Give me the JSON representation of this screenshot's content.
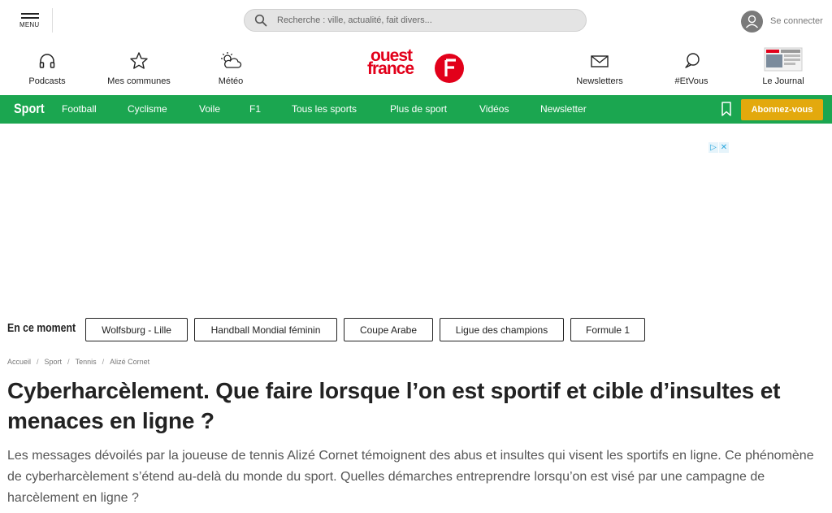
{
  "header": {
    "menu_label": "MENU",
    "search_placeholder": "Recherche : ville, actualité, fait divers...",
    "login_label": "Se connecter"
  },
  "quick_links": [
    {
      "label": "Podcasts",
      "icon": "headphones-icon"
    },
    {
      "label": "Mes communes",
      "icon": "star-icon"
    },
    {
      "label": "Météo",
      "icon": "sun-cloud-icon"
    },
    {
      "label": "Newsletters",
      "icon": "envelope-icon"
    },
    {
      "label": "#EtVous",
      "icon": "chat-bubble-icon"
    },
    {
      "label": "Le Journal",
      "icon": "newspaper-icon"
    }
  ],
  "logo": {
    "line1": "ouest",
    "line2": "france"
  },
  "sport_nav": {
    "title": "Sport",
    "links": [
      "Football",
      "Cyclisme",
      "Voile",
      "F1",
      "Tous les sports",
      "Plus de sport",
      "Vidéos",
      "Newsletter"
    ],
    "subscribe_label": "Abonnez-vous"
  },
  "ad": {
    "choices_icons": [
      "▷",
      "✕"
    ]
  },
  "trending": {
    "label": "En ce moment",
    "chips": [
      "Wolfsburg - Lille",
      "Handball Mondial féminin",
      "Coupe Arabe",
      "Ligue des champions",
      "Formule 1"
    ]
  },
  "article": {
    "breadcrumb": [
      "Accueil",
      "Sport",
      "Tennis",
      "Alizé Cornet"
    ],
    "title": "Cyberharcèlement. Que faire lorsque l’on est sportif et cible d’insultes et menaces en ligne ?",
    "lede": "Les messages dévoilés par la joueuse de tennis Alizé Cornet témoignent des abus et insultes qui visent les sportifs en ligne. Ce phénomène de cyberharcèlement s’étend au-delà du monde du sport. Quelles démarches entreprendre lorsqu’on est visé par une campagne de harcèlement en ligne ?"
  },
  "colors": {
    "brand_red": "#e2001a",
    "sport_green": "#1ba650",
    "subscribe_gold": "#e3a90d"
  }
}
